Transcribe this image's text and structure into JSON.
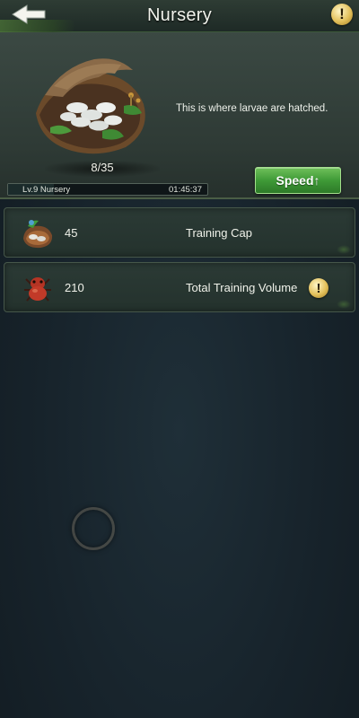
{
  "header": {
    "title": "Nursery",
    "back_icon": "back-arrow-icon",
    "info_icon": "exclamation-icon",
    "info_glyph": "!"
  },
  "building": {
    "description": "This is where larvae are hatched.",
    "count": "8/35",
    "level_name": "Lv.9 Nursery",
    "timer": "01:45:37",
    "progress_fraction": 0.23,
    "speed_label": "Speed↑"
  },
  "stats": [
    {
      "icon": "larva-nest-icon",
      "value": "45",
      "label": "Training Cap"
    },
    {
      "icon": "red-ant-icon",
      "value": "210",
      "label": "Total Training Volume",
      "hint_glyph": "!"
    }
  ],
  "colors": {
    "accent_green": "#3f9a37",
    "hint_gold": "#e3c05a",
    "background": "#1a2730"
  }
}
